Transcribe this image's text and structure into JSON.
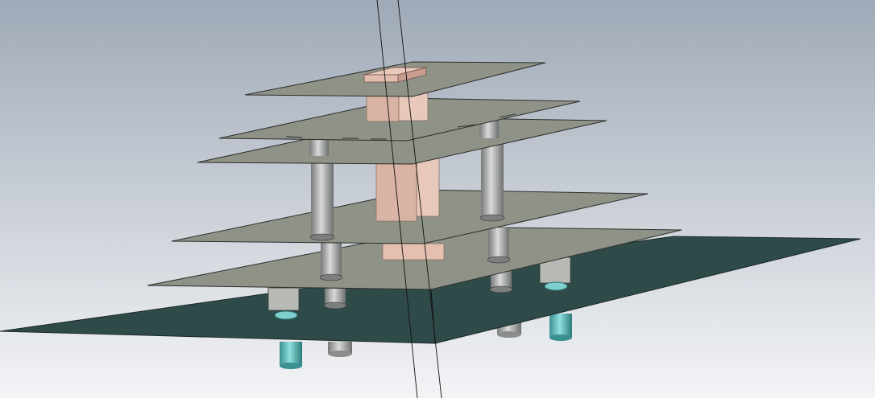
{
  "viewport": {
    "background_top": "#9fa9b7",
    "background_bottom": "#f3f4f6"
  },
  "scene": {
    "plate_color": "#8e9287",
    "plate_edge": "#2c2e2b",
    "ground_color": "#2f4b49",
    "ground_edge": "#1a2826",
    "block_color": "#e5c0b0",
    "block_shade": "#c99e8e",
    "post_color": "#a8abaa",
    "foot_color": "#5fb9b9",
    "foot_shade": "#3a8f90",
    "bracket_color": "#b8bab6",
    "axis_line_color": "#111111"
  }
}
